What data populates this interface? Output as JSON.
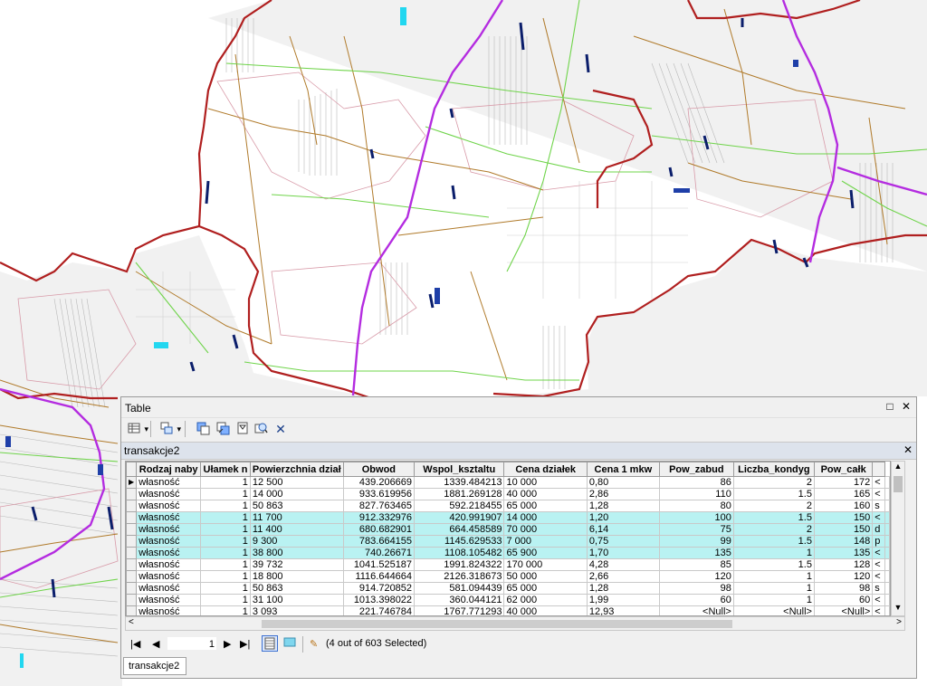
{
  "table_window": {
    "title": "Table",
    "restore_glyph": "□",
    "close_glyph": "✕",
    "layer_tab": "transakcje2",
    "layer_close_glyph": "✕",
    "bottom_tab": "transakcje2",
    "columns": [
      "Rodzaj naby",
      "Ułamek n",
      "Powierzchnia dział",
      "Obwod",
      "Wspol_ksztaltu",
      "Cena działek",
      "Cena 1 mkw",
      "Pow_zabud",
      "Liczba_kondyg",
      "Pow_całk",
      ""
    ],
    "rows": [
      {
        "cells": [
          "własność",
          "1",
          "12 500",
          "439.206669",
          "1339.484213",
          "10 000",
          "0,80",
          "86",
          "2",
          "172",
          "<"
        ],
        "selected": false,
        "current": true
      },
      {
        "cells": [
          "własność",
          "1",
          "14 000",
          "933.619956",
          "1881.269128",
          "40 000",
          "2,86",
          "110",
          "1.5",
          "165",
          "<"
        ],
        "selected": false,
        "current": false
      },
      {
        "cells": [
          "własność",
          "1",
          "50 863",
          "827.763465",
          "592.218455",
          "65 000",
          "1,28",
          "80",
          "2",
          "160",
          "s"
        ],
        "selected": false,
        "current": false
      },
      {
        "cells": [
          "własność",
          "1",
          "11 700",
          "912.332976",
          "420.991907",
          "14 000",
          "1,20",
          "100",
          "1.5",
          "150",
          "<"
        ],
        "selected": true,
        "current": false
      },
      {
        "cells": [
          "własność",
          "1",
          "11 400",
          "680.682901",
          "664.458589",
          "70 000",
          "6,14",
          "75",
          "2",
          "150",
          "d"
        ],
        "selected": true,
        "current": false
      },
      {
        "cells": [
          "własność",
          "1",
          "9 300",
          "783.664155",
          "1145.629533",
          "7 000",
          "0,75",
          "99",
          "1.5",
          "148",
          "p"
        ],
        "selected": true,
        "current": false
      },
      {
        "cells": [
          "własność",
          "1",
          "38 800",
          "740.26671",
          "1108.105482",
          "65 900",
          "1,70",
          "135",
          "1",
          "135",
          "<"
        ],
        "selected": true,
        "current": false
      },
      {
        "cells": [
          "własność",
          "1",
          "39 732",
          "1041.525187",
          "1991.824322",
          "170 000",
          "4,28",
          "85",
          "1.5",
          "128",
          "<"
        ],
        "selected": false,
        "current": false
      },
      {
        "cells": [
          "własność",
          "1",
          "18 800",
          "1116.644664",
          "2126.318673",
          "50 000",
          "2,66",
          "120",
          "1",
          "120",
          "<"
        ],
        "selected": false,
        "current": false
      },
      {
        "cells": [
          "własność",
          "1",
          "50 863",
          "914.720852",
          "581.094439",
          "65 000",
          "1,28",
          "98",
          "1",
          "98",
          "s"
        ],
        "selected": false,
        "current": false
      },
      {
        "cells": [
          "własność",
          "1",
          "31 100",
          "1013.398022",
          "360.044121",
          "62 000",
          "1,99",
          "60",
          "1",
          "60",
          "<"
        ],
        "selected": false,
        "current": false
      },
      {
        "cells": [
          "własność",
          "1",
          "3 093",
          "221.746784",
          "1767.771293",
          "40 000",
          "12,93",
          "<Null>",
          "<Null>",
          "<Null>",
          "<"
        ],
        "selected": false,
        "current": false
      }
    ],
    "record_number": "1",
    "selection_info": "(4 out of 603 Selected)"
  },
  "colors": {
    "selected_row": "#b9f2f2",
    "boundary_red": "#b01f1f",
    "road_purple": "#b42ce0",
    "road_green": "#6fd44a",
    "road_brown": "#b07a2a",
    "parcel_blue": "#1f3fa8"
  },
  "icons": [
    "table-options-icon",
    "related-tables-icon",
    "select-by-attributes-icon",
    "switch-selection-icon",
    "clear-selection-icon",
    "zoom-to-selected-icon",
    "delete-selected-icon",
    "first-record-icon",
    "previous-record-icon",
    "next-record-icon",
    "last-record-icon",
    "show-all-records-icon",
    "show-selected-records-icon",
    "pencil-icon"
  ]
}
